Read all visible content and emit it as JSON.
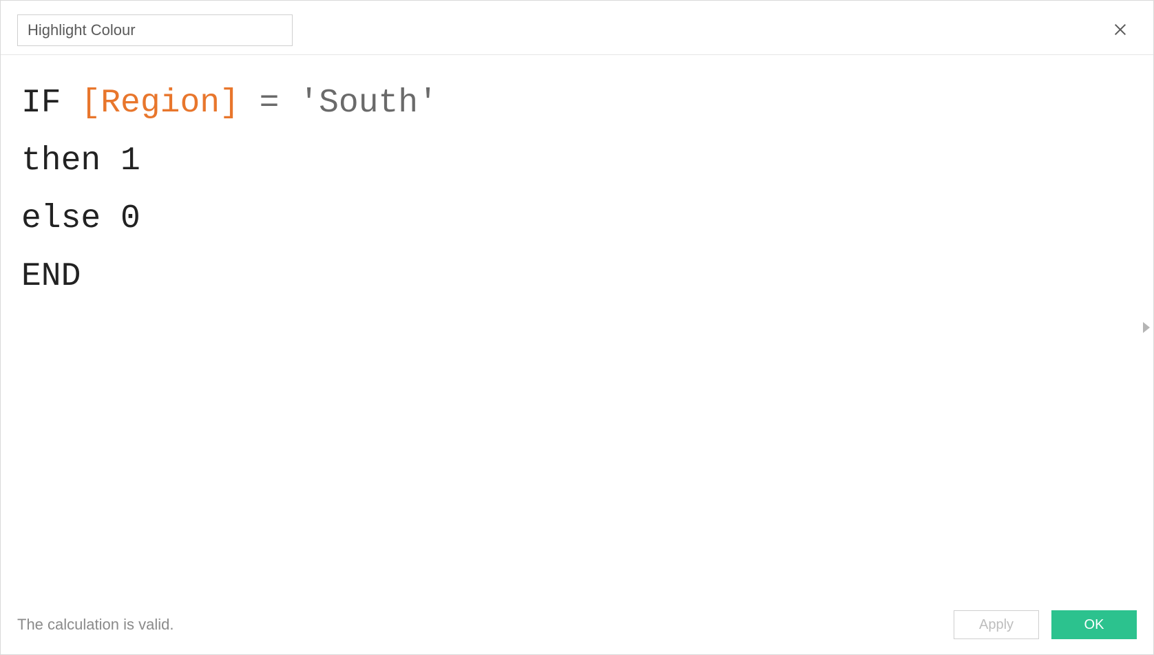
{
  "field_name": "Highlight Colour",
  "formula": {
    "lines": [
      [
        {
          "cls": "tok-keyword",
          "text": "IF "
        },
        {
          "cls": "tok-field",
          "text": "[Region]"
        },
        {
          "cls": "tok-op",
          "text": " = "
        },
        {
          "cls": "tok-string",
          "text": "'South'"
        }
      ],
      [
        {
          "cls": "tok-keyword",
          "text": "then 1"
        }
      ],
      [
        {
          "cls": "tok-keyword",
          "text": "else 0"
        }
      ],
      [
        {
          "cls": "tok-keyword",
          "text": "END"
        }
      ]
    ]
  },
  "status_text": "The calculation is valid.",
  "buttons": {
    "apply": "Apply",
    "ok": "OK"
  }
}
